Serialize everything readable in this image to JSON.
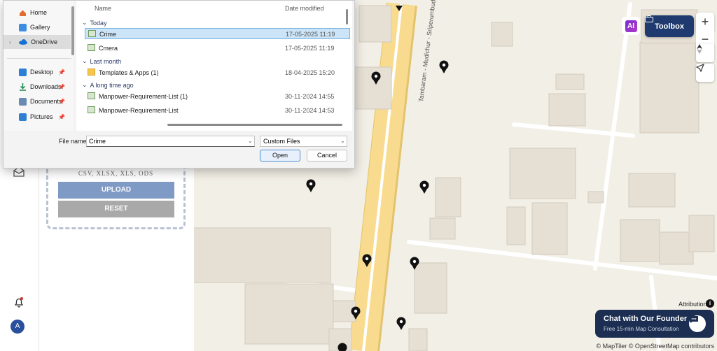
{
  "map": {
    "road_label": "Tambaram - Mudichur - Sriperumbudur",
    "toolbox_label": "Toolbox",
    "ai_icon": "ai-sparkle-icon",
    "zoom_in": "+",
    "zoom_out": "−",
    "attribution": "Attribution",
    "attribution_icon": "i",
    "copyright": "© MapTiler © OpenStreetMap contributors",
    "founder_title": "Chat with Our Founder",
    "founder_subtitle": "Free 15-min Map Consultation"
  },
  "panel": {
    "formats": "CSV, XLSX, XLS, ODS",
    "upload": "UPLOAD",
    "reset": "RESET",
    "avatar": "A"
  },
  "dialog": {
    "nav": [
      {
        "label": "Home",
        "icon": "home-icon"
      },
      {
        "label": "Gallery",
        "icon": "gallery-icon"
      },
      {
        "label": "OneDrive",
        "icon": "cloud-icon"
      },
      {
        "label": "Desktop",
        "icon": "desktop-icon"
      },
      {
        "label": "Downloads",
        "icon": "download-icon"
      },
      {
        "label": "Documents",
        "icon": "documents-icon"
      },
      {
        "label": "Pictures",
        "icon": "pictures-icon"
      }
    ],
    "columns": {
      "name": "Name",
      "date": "Date modified"
    },
    "groups": {
      "today": "Today",
      "last_month": "Last month",
      "long_ago": "A long time ago"
    },
    "files": [
      {
        "name": "Crime",
        "date": "17-05-2025 11:19"
      },
      {
        "name": "Cmera",
        "date": "17-05-2025 11:19"
      },
      {
        "name": "Templates & Apps (1)",
        "date": "18-04-2025 15:20"
      },
      {
        "name": "Manpower-Requirement-List (1)",
        "date": "30-11-2024 14:55"
      },
      {
        "name": "Manpower-Requirement-List",
        "date": "30-11-2024 14:53"
      }
    ],
    "file_name_label": "File name:",
    "file_name_value": "Crime",
    "file_type": "Custom Files",
    "open": "Open",
    "cancel": "Cancel"
  }
}
